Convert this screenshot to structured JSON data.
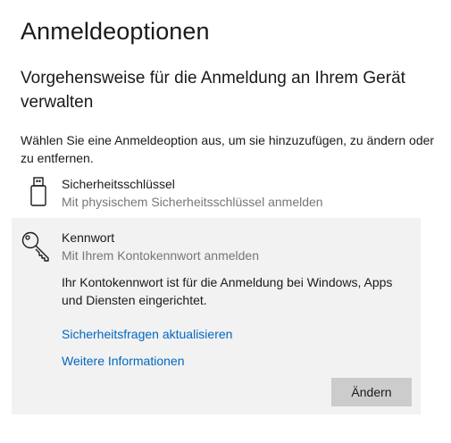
{
  "page": {
    "title": "Anmeldeoptionen"
  },
  "section": {
    "title": "Vorgehensweise für die Anmeldung an Ihrem Gerät verwalten",
    "description": "Wählen Sie eine Anmeldeoption aus, um sie hinzuzufügen, zu ändern oder zu entfernen."
  },
  "options": {
    "security_key": {
      "icon": "usb-key-icon",
      "title": "Sicherheitsschlüssel",
      "subtitle": "Mit physischem Sicherheitsschlüssel anmelden"
    },
    "password": {
      "icon": "key-icon",
      "title": "Kennwort",
      "subtitle": "Mit Ihrem Kontokennwort anmelden",
      "detail": "Ihr Kontokennwort ist für die Anmeldung bei Windows, Apps und Diensten eingerichtet.",
      "link_security_questions": "Sicherheitsfragen aktualisieren",
      "link_more_info": "Weitere Informationen",
      "change_button": "Ändern"
    }
  },
  "colors": {
    "link": "#0067c0",
    "selected_background": "#f2f2f2",
    "button_background": "#cccccc",
    "secondary_text": "#767676"
  }
}
